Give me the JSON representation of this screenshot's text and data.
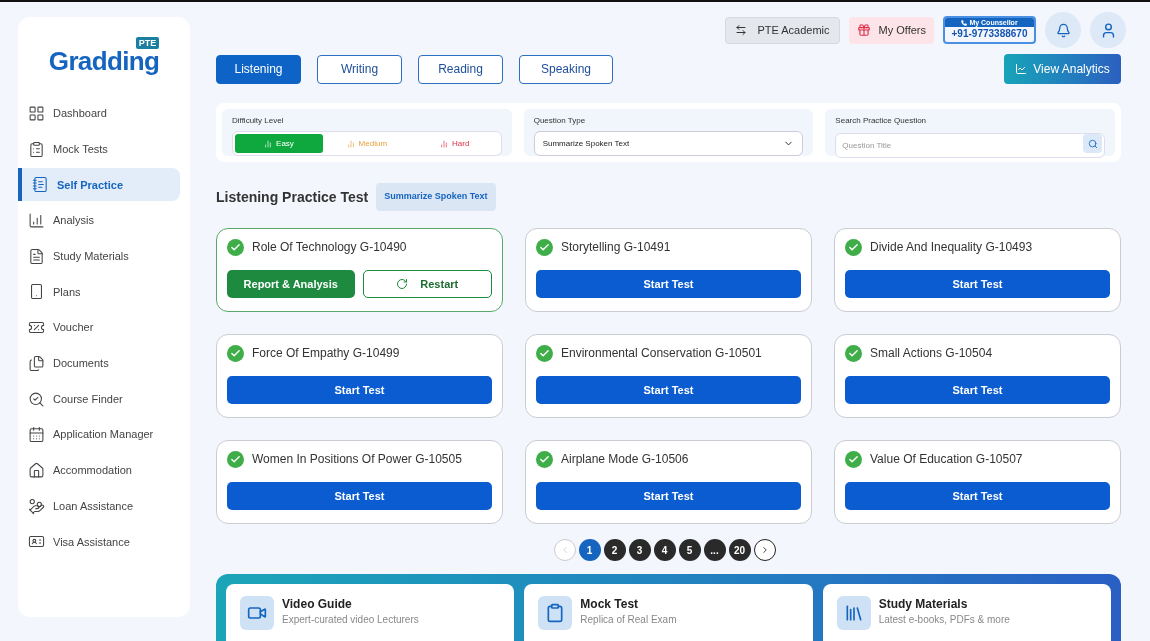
{
  "sidebar": {
    "logo": "Gradding",
    "logo_badge": "PTE",
    "items": [
      {
        "label": "Dashboard",
        "selected": false
      },
      {
        "label": "Mock Tests",
        "selected": false
      },
      {
        "label": "Self Practice",
        "selected": true
      },
      {
        "label": "Analysis",
        "selected": false
      },
      {
        "label": "Study Materials",
        "selected": false
      },
      {
        "label": "Plans",
        "selected": false
      },
      {
        "label": "Voucher",
        "selected": false
      },
      {
        "label": "Documents",
        "selected": false
      },
      {
        "label": "Course Finder",
        "selected": false
      },
      {
        "label": "Application Manager",
        "selected": false
      },
      {
        "label": "Accommodation",
        "selected": false
      },
      {
        "label": "Loan Assistance",
        "selected": false
      },
      {
        "label": "Visa Assistance",
        "selected": false
      }
    ]
  },
  "header": {
    "exam": "PTE Academic",
    "offers": "My Offers",
    "counsellor_label": "My Counsellor",
    "counsellor_phone": "+91-9773388670"
  },
  "tabs": [
    {
      "label": "Listening",
      "selected": true
    },
    {
      "label": "Writing",
      "selected": false
    },
    {
      "label": "Reading",
      "selected": false
    },
    {
      "label": "Speaking",
      "selected": false
    }
  ],
  "analytics_button": "View Analytics",
  "filters": {
    "difficulty_label": "Difficulty Level",
    "difficulty": [
      {
        "label": "Easy",
        "selected": true
      },
      {
        "label": "Medium",
        "selected": false
      },
      {
        "label": "Hard",
        "selected": false
      }
    ],
    "question_type_label": "Question Type",
    "question_type": "Summarize Spoken Text",
    "search_label": "Search Practice Question",
    "search_placeholder": "Question Title"
  },
  "section": {
    "title": "Listening Practice Test",
    "tag": "Summarize Spoken Text"
  },
  "tests": [
    {
      "title": "Role Of Technology G-10490",
      "completed": true,
      "kind": "attempted",
      "buttons": [
        "Report & Analysis",
        "Restart"
      ]
    },
    {
      "title": "Storytelling G-10491",
      "completed": true,
      "kind": "new",
      "buttons": [
        "Start Test"
      ]
    },
    {
      "title": "Divide And Inequality G-10493",
      "completed": true,
      "kind": "new",
      "buttons": [
        "Start Test"
      ]
    },
    {
      "title": "Force Of Empathy G-10499",
      "completed": true,
      "kind": "new",
      "buttons": [
        "Start Test"
      ]
    },
    {
      "title": "Environmental Conservation G-10501",
      "completed": true,
      "kind": "new",
      "buttons": [
        "Start Test"
      ]
    },
    {
      "title": "Small Actions G-10504",
      "completed": true,
      "kind": "new",
      "buttons": [
        "Start Test"
      ]
    },
    {
      "title": "Women In Positions Of Power G-10505",
      "completed": true,
      "kind": "new",
      "buttons": [
        "Start Test"
      ]
    },
    {
      "title": "Airplane Mode G-10506",
      "completed": true,
      "kind": "new",
      "buttons": [
        "Start Test"
      ]
    },
    {
      "title": "Value Of Education G-10507",
      "completed": true,
      "kind": "new",
      "buttons": [
        "Start Test"
      ]
    }
  ],
  "pagination": {
    "pages": [
      {
        "label": "1",
        "selected": true
      },
      {
        "label": "2",
        "selected": false
      },
      {
        "label": "3",
        "selected": false
      },
      {
        "label": "4",
        "selected": false
      },
      {
        "label": "5",
        "selected": false
      },
      {
        "label": "...",
        "selected": false
      },
      {
        "label": "20",
        "selected": false
      }
    ],
    "prev_disabled": true,
    "next_disabled": false
  },
  "resources": [
    {
      "title": "Video Guide",
      "subtitle": "Expert-curated video Lecturers"
    },
    {
      "title": "Mock Test",
      "subtitle": "Replica of Real Exam"
    },
    {
      "title": "Study Materials",
      "subtitle": "Latest e-books, PDFs & more"
    }
  ]
}
